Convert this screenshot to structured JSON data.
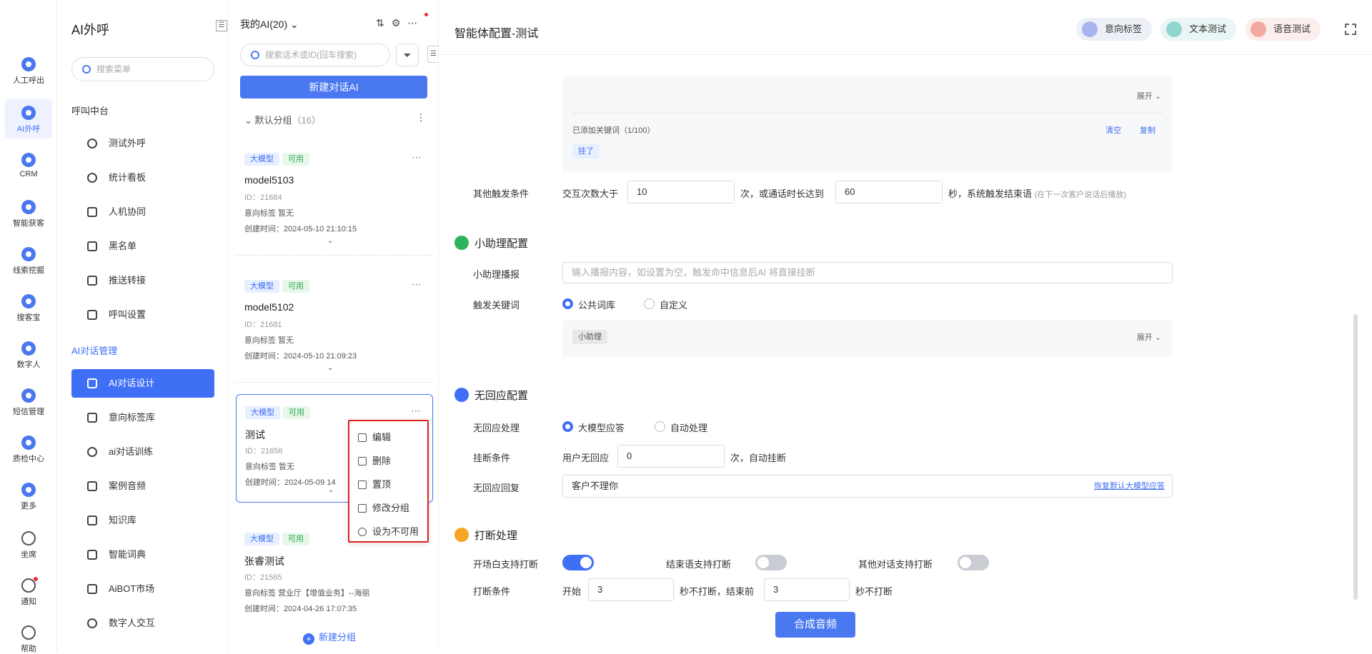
{
  "rail": [
    {
      "label": "人工呼出",
      "icon": "phone-out-icon"
    },
    {
      "label": "AI外呼",
      "icon": "ai-call-icon",
      "active": true
    },
    {
      "label": "CRM",
      "icon": "crm-icon"
    },
    {
      "label": "智能获客",
      "icon": "acquire-icon"
    },
    {
      "label": "线索挖掘",
      "icon": "clue-icon"
    },
    {
      "label": "搜客宝",
      "icon": "search-customer-icon"
    },
    {
      "label": "数字人",
      "icon": "digital-human-icon"
    },
    {
      "label": "短信管理",
      "icon": "sms-icon"
    },
    {
      "label": "质检中心",
      "icon": "quality-icon"
    },
    {
      "label": "更多",
      "icon": "more-icon"
    },
    {
      "label": "坐席",
      "icon": "headset-icon"
    },
    {
      "label": "通知",
      "icon": "bell-icon"
    },
    {
      "label": "帮助",
      "icon": "help-icon"
    }
  ],
  "menu": {
    "title": "AI外呼",
    "search_placeholder": "搜索菜单",
    "group1": "呼叫中台",
    "group1_items": [
      "测试外呼",
      "统计看板",
      "人机协同",
      "黑名单",
      "推送转接",
      "呼叫设置"
    ],
    "group2": "AI对话管理",
    "group2_items": [
      "AI对话设计",
      "意向标签库",
      "ai对话训练",
      "案例音频",
      "知识库",
      "智能词典",
      "AiBOT市场",
      "数字人交互"
    ]
  },
  "list": {
    "header": "我的AI(20)",
    "search_placeholder": "搜索话术或ID(回车搜索)",
    "new_button": "新建对话AI",
    "group_name": "默认分组",
    "group_count": "（16）",
    "cards": [
      {
        "tag1": "大模型",
        "tag2": "可用",
        "name": "model5103",
        "id": "ID：21684",
        "intent": "意向标签    暂无",
        "time": "创建时间：2024-05-10 21:10:15"
      },
      {
        "tag1": "大模型",
        "tag2": "可用",
        "name": "model5102",
        "id": "ID：21681",
        "intent": "意向标签    暂无",
        "time": "创建时间：2024-05-10 21:09:23"
      },
      {
        "tag1": "大模型",
        "tag2": "可用",
        "name": "测试",
        "id": "ID：21656",
        "intent": "意向标签    暂无",
        "time": "创建时间：2024-05-09 14"
      },
      {
        "tag1": "大模型",
        "tag2": "可用",
        "name": "张睿测试",
        "id": "ID：21565",
        "intent": "意向标签    营业厅【增值业务】--海丽",
        "time": "创建时间：2024-04-26 17:07:35"
      }
    ],
    "popup": [
      "编辑",
      "删除",
      "置顶",
      "修改分组",
      "设为不可用"
    ],
    "new_group": "新建分组"
  },
  "main": {
    "title": "智能体配置-测试",
    "top_buttons": [
      "意向标签",
      "文本测试",
      "语音测试"
    ],
    "kw": {
      "expand": "展开",
      "added": "已添加关键词（1/100）",
      "clear": "清空",
      "copy": "复制",
      "chip": "挂了"
    },
    "other_trigger": {
      "label": "其他触发条件",
      "pre": "交互次数大于",
      "count": "10",
      "mid": "次，或通话时长达到",
      "secs": "60",
      "post": "秒，系统触发结束语",
      "note": "(在下一次客户说话后播放)"
    },
    "assistant": {
      "section": "小助理配置",
      "broadcast_label": "小助理播报",
      "broadcast_placeholder": "输入播报内容，如设置为空，触发命中信息后AI 将直接挂断",
      "keyword_label": "触发关键词",
      "opt_public": "公共词库",
      "opt_custom": "自定义",
      "chip": "小助理",
      "expand": "展开"
    },
    "noreply": {
      "section": "无回应配置",
      "handle_label": "无回应处理",
      "opt_llm": "大模型应答",
      "opt_auto": "自动处理",
      "hang_label": "挂断条件",
      "hang_pre": "用户无回应",
      "hang_count": "0",
      "hang_post": "次，自动挂断",
      "reply_label": "无回应回复",
      "reply_value": "客户不理你",
      "reply_link": "恢复默认大模型应答"
    },
    "interrupt": {
      "section": "打断处理",
      "open_label": "开场白支持打断",
      "end_label": "结束语支持打断",
      "other_label": "其他对话支持打断",
      "cond_label": "打断条件",
      "start": "开始",
      "start_val": "3",
      "mid": "秒不打断，结束前",
      "end_val": "3",
      "post": "秒不打断"
    },
    "synth_button": "合成音频"
  }
}
